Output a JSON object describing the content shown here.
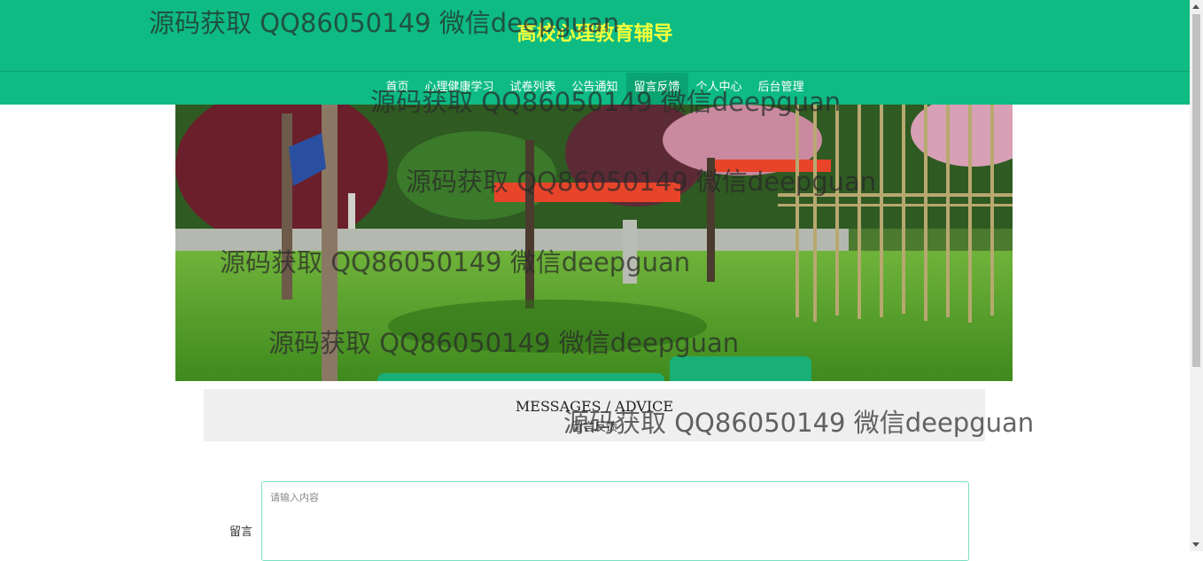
{
  "header": {
    "site_title": "高校心理教育辅导"
  },
  "nav": {
    "items": [
      {
        "label": "首页",
        "active": false
      },
      {
        "label": "心理健康学习",
        "active": false
      },
      {
        "label": "试卷列表",
        "active": false
      },
      {
        "label": "公告通知",
        "active": false
      },
      {
        "label": "留言反馈",
        "active": true
      },
      {
        "label": "个人中心",
        "active": false
      },
      {
        "label": "后台管理",
        "active": false
      }
    ]
  },
  "section": {
    "title": "MESSAGES / ADVICE",
    "subtitle": "留言反馈"
  },
  "form": {
    "message_label": "留言",
    "message_placeholder": "请输入内容"
  },
  "watermark": {
    "text": "源码获取 QQ86050149 微信deepguan"
  },
  "colors": {
    "header_bg": "#0dbb83",
    "nav_active_bg": "#0aa472",
    "title_color": "#f6ff3a",
    "section_bg": "#efefef",
    "input_border": "#7be0c0"
  }
}
